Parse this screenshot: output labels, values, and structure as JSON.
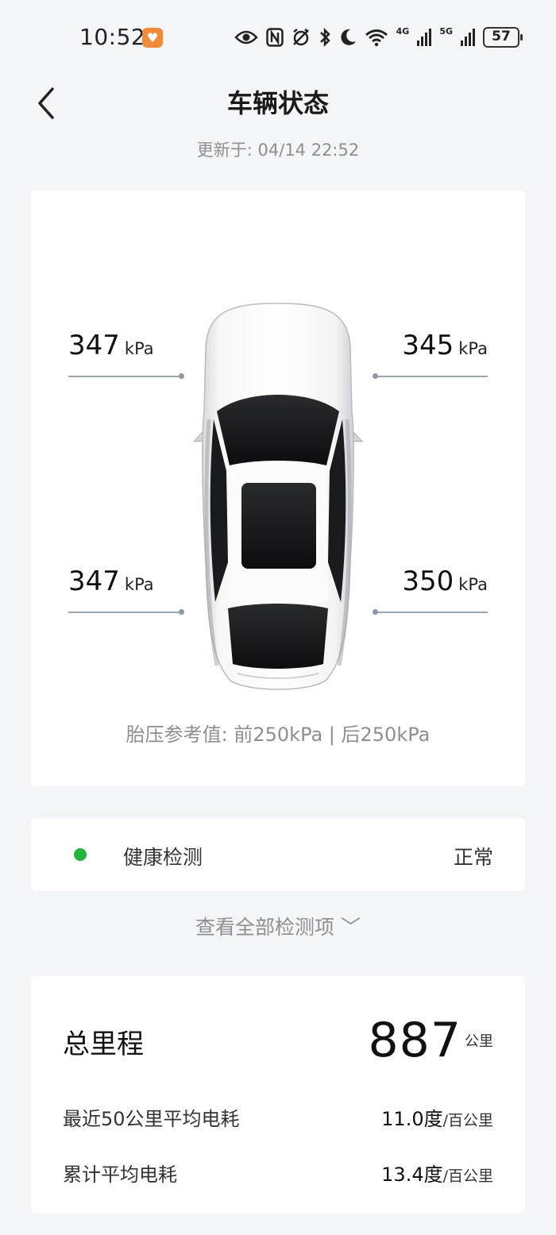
{
  "status_bar": {
    "time": "10:52",
    "badge": "♥",
    "net_4g": "4G",
    "net_5g": "5G",
    "battery": "57"
  },
  "header": {
    "title": "车辆状态",
    "updated": "更新于: 04/14 22:52"
  },
  "tires": {
    "front_left": {
      "value": "347",
      "unit": "kPa"
    },
    "front_right": {
      "value": "345",
      "unit": "kPa"
    },
    "rear_left": {
      "value": "347",
      "unit": "kPa"
    },
    "rear_right": {
      "value": "350",
      "unit": "kPa"
    },
    "reference": "胎压参考值:  前250kPa | 后250kPa"
  },
  "health": {
    "label": "健康检测",
    "status": "正常",
    "status_color": "#23b43e"
  },
  "view_all": "查看全部检测项 ﹀",
  "mileage": {
    "title": "总里程",
    "value": "887",
    "unit": "公里",
    "recent_label": "最近50公里平均电耗",
    "recent_value": "11.0度",
    "recent_unit": "/百公里",
    "total_label": "累计平均电耗",
    "total_value": "13.4度",
    "total_unit": "/百公里"
  }
}
